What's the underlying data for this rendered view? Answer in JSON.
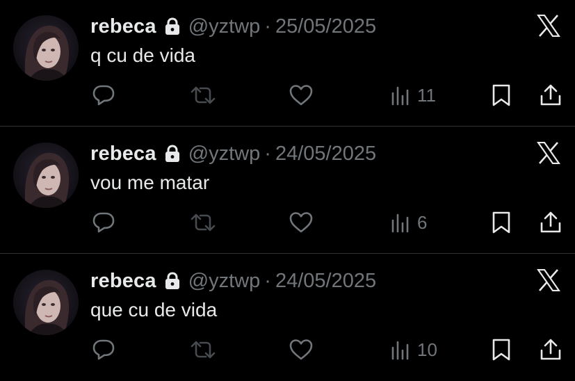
{
  "colors": {
    "background": "#000000",
    "text_primary": "#e7e9ea",
    "text_secondary": "#71767b",
    "divider": "#2f3336"
  },
  "icons": {
    "lock": "lock-icon",
    "platform": "x-logo-icon",
    "reply": "reply-icon",
    "retweet": "retweet-icon",
    "like": "heart-icon",
    "views": "views-chart-icon",
    "bookmark": "bookmark-icon",
    "share": "share-icon"
  },
  "tweets": [
    {
      "display_name": "rebeca",
      "handle": "@yztwp",
      "separator": "·",
      "date": "25/05/2025",
      "text": "q cu de vida",
      "views": "11"
    },
    {
      "display_name": "rebeca",
      "handle": "@yztwp",
      "separator": "·",
      "date": "24/05/2025",
      "text": "vou me matar",
      "views": "6"
    },
    {
      "display_name": "rebeca",
      "handle": "@yztwp",
      "separator": "·",
      "date": "24/05/2025",
      "text": "que cu de vida",
      "views": "10"
    }
  ]
}
